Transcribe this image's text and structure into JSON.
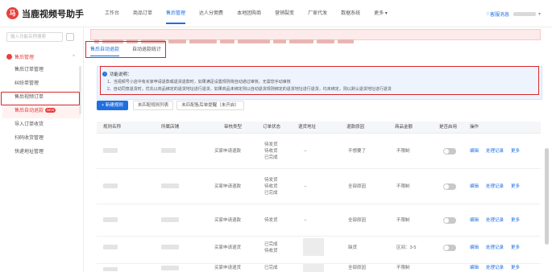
{
  "app": {
    "logo_mark": "马",
    "title": "当鹿视频号助手"
  },
  "nav": [
    {
      "label": "工作台",
      "active": false
    },
    {
      "label": "商品订单",
      "active": false
    },
    {
      "label": "售后管理",
      "active": true
    },
    {
      "label": "达人分佣费",
      "active": false
    },
    {
      "label": "本地团购商",
      "active": false
    },
    {
      "label": "营销裂变",
      "active": false
    },
    {
      "label": "厂家代发",
      "active": false
    },
    {
      "label": "数据系统",
      "active": false
    },
    {
      "label": "更多",
      "active": false
    }
  ],
  "top_right": {
    "label": "客服消息"
  },
  "sidebar": {
    "search_placeholder": "输入功能名称搜索",
    "group_label": "售后管理",
    "items": [
      {
        "label": "售后订单管理",
        "active": false,
        "badge": ""
      },
      {
        "label": "纠纷单管理",
        "active": false,
        "badge": ""
      },
      {
        "label": "售后视频订单",
        "active": false,
        "badge": ""
      },
      {
        "label": "售后自动退款",
        "active": true,
        "badge": "NEW"
      },
      {
        "label": "导入订单收货",
        "active": false,
        "badge": ""
      },
      {
        "label": "扫码收货管理",
        "active": false,
        "badge": ""
      },
      {
        "label": "快递地址管理",
        "active": false,
        "badge": ""
      }
    ]
  },
  "tabs": [
    {
      "label": "售后自动退款",
      "active": true
    },
    {
      "label": "自动退款统计",
      "active": false
    }
  ],
  "info": {
    "title": "功能说明：",
    "lines": [
      "1、当视频号小店中有买家申请退款或退货退款时，如果满足设置规则将自动通过审核，无需您手动审核",
      "2、自动同意退货时，优先以商品绑定的退货地址进行退货，如果商品未绑定则以自动退货规则绑定的退货地址进行退货，均未绑定，则以默认退货地址进行退货"
    ]
  },
  "toolbar": {
    "add_rule": "+ 新建规则",
    "btn_list": "未匹配规则列表",
    "btn_remind": "未匹配售后单提醒（未开启）"
  },
  "table": {
    "headers": [
      "规则名称",
      "所属店铺",
      "审核类型",
      "订单状态",
      "退货地址",
      "退款原因",
      "商品金额",
      "是否启用",
      "操作"
    ],
    "rows": [
      {
        "type": "买家申请退款",
        "status": [
          "待发货",
          "待收货",
          "已完成"
        ],
        "address": "--",
        "reason": "不想要了",
        "amount": "不限制",
        "actions": [
          "编辑",
          "处理记录",
          "更多"
        ]
      },
      {
        "type": "买家申请退款",
        "status": [
          "待发货",
          "待收货",
          "已完成"
        ],
        "address": "--",
        "reason": "全部原因",
        "amount": "不限制",
        "actions": [
          "编辑",
          "处理记录",
          "更多"
        ]
      },
      {
        "type": "买家申请退款",
        "status": [
          "待发货"
        ],
        "address": "--",
        "reason": "全部原因",
        "amount": "不限制",
        "actions": [
          "编辑",
          "处理记录",
          "更多"
        ]
      },
      {
        "type": "买家申请退货",
        "status": [
          "已完成",
          "待收货"
        ],
        "address": "",
        "reason": "缺货",
        "amount": "区间：3-5",
        "actions": [
          "编辑",
          "处理记录",
          "更多"
        ]
      },
      {
        "type": "买家申请退货",
        "status": [
          "已完成"
        ],
        "address": "",
        "reason": "全部原因",
        "amount": "不限制",
        "actions": [
          "编辑",
          "处理记录",
          "更多"
        ]
      }
    ]
  }
}
